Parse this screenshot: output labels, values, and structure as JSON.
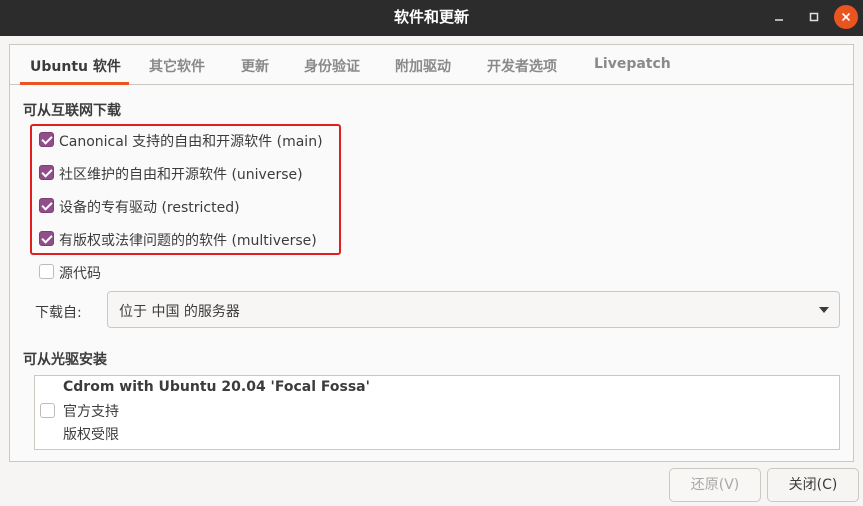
{
  "window": {
    "title": "软件和更新"
  },
  "tabs": [
    "Ubuntu 软件",
    "其它软件",
    "更新",
    "身份验证",
    "附加驱动",
    "开发者选项",
    "Livepatch"
  ],
  "internet": {
    "heading": "可从互联网下载",
    "options": [
      {
        "label": "Canonical 支持的自由和开源软件 (main)",
        "checked": true
      },
      {
        "label": "社区维护的自由和开源软件 (universe)",
        "checked": true
      },
      {
        "label": "设备的专有驱动 (restricted)",
        "checked": true
      },
      {
        "label": "有版权或法律问题的的软件 (multiverse)",
        "checked": true
      },
      {
        "label": "源代码",
        "checked": false
      }
    ],
    "download_from_label": "下载自:",
    "download_from_value": "位于 中国 的服务器"
  },
  "cdrom": {
    "heading": "可从光驱安装",
    "title": "Cdrom with Ubuntu 20.04 'Focal Fossa'",
    "line2": "官方支持",
    "line3": "版权受限",
    "checked": false
  },
  "buttons": {
    "revert": "还原(V)",
    "close": "关闭(C)"
  },
  "colors": {
    "accent": "#e95420",
    "checkbox": "#924d8b",
    "highlight": "#e02020"
  }
}
